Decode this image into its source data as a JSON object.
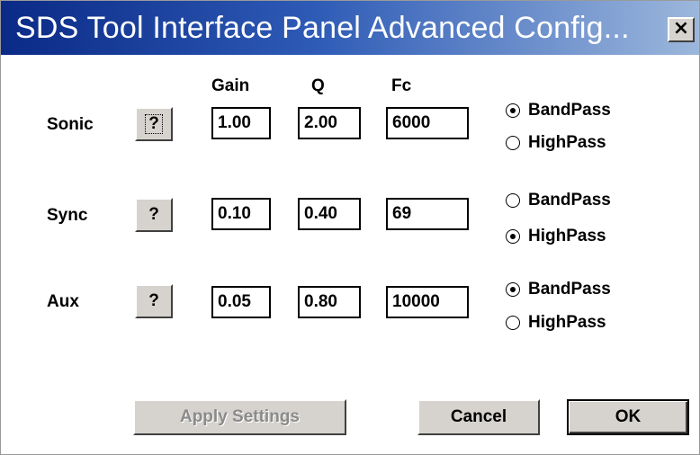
{
  "window": {
    "title": "SDS Tool Interface Panel Advanced Config...",
    "close_glyph": "×"
  },
  "columns": {
    "gain": "Gain",
    "q": "Q",
    "fc": "Fc"
  },
  "rows": [
    {
      "label": "Sonic",
      "help_label": "?",
      "gain": "1.00",
      "q": "2.00",
      "fc": "6000",
      "options": [
        "BandPass",
        "HighPass"
      ],
      "selected": "BandPass"
    },
    {
      "label": "Sync",
      "help_label": "?",
      "gain": "0.10",
      "q": "0.40",
      "fc": "69",
      "options": [
        "BandPass",
        "HighPass"
      ],
      "selected": "HighPass"
    },
    {
      "label": "Aux",
      "help_label": "?",
      "gain": "0.05",
      "q": "0.80",
      "fc": "10000",
      "options": [
        "BandPass",
        "HighPass"
      ],
      "selected": "BandPass"
    }
  ],
  "buttons": {
    "apply": "Apply Settings",
    "cancel": "Cancel",
    "ok": "OK"
  },
  "colors": {
    "titlebar_start": "#0a2a86",
    "titlebar_end": "#9cb7dc",
    "button_face": "#d6d3ce",
    "disabled_text": "#8a8a8a"
  }
}
